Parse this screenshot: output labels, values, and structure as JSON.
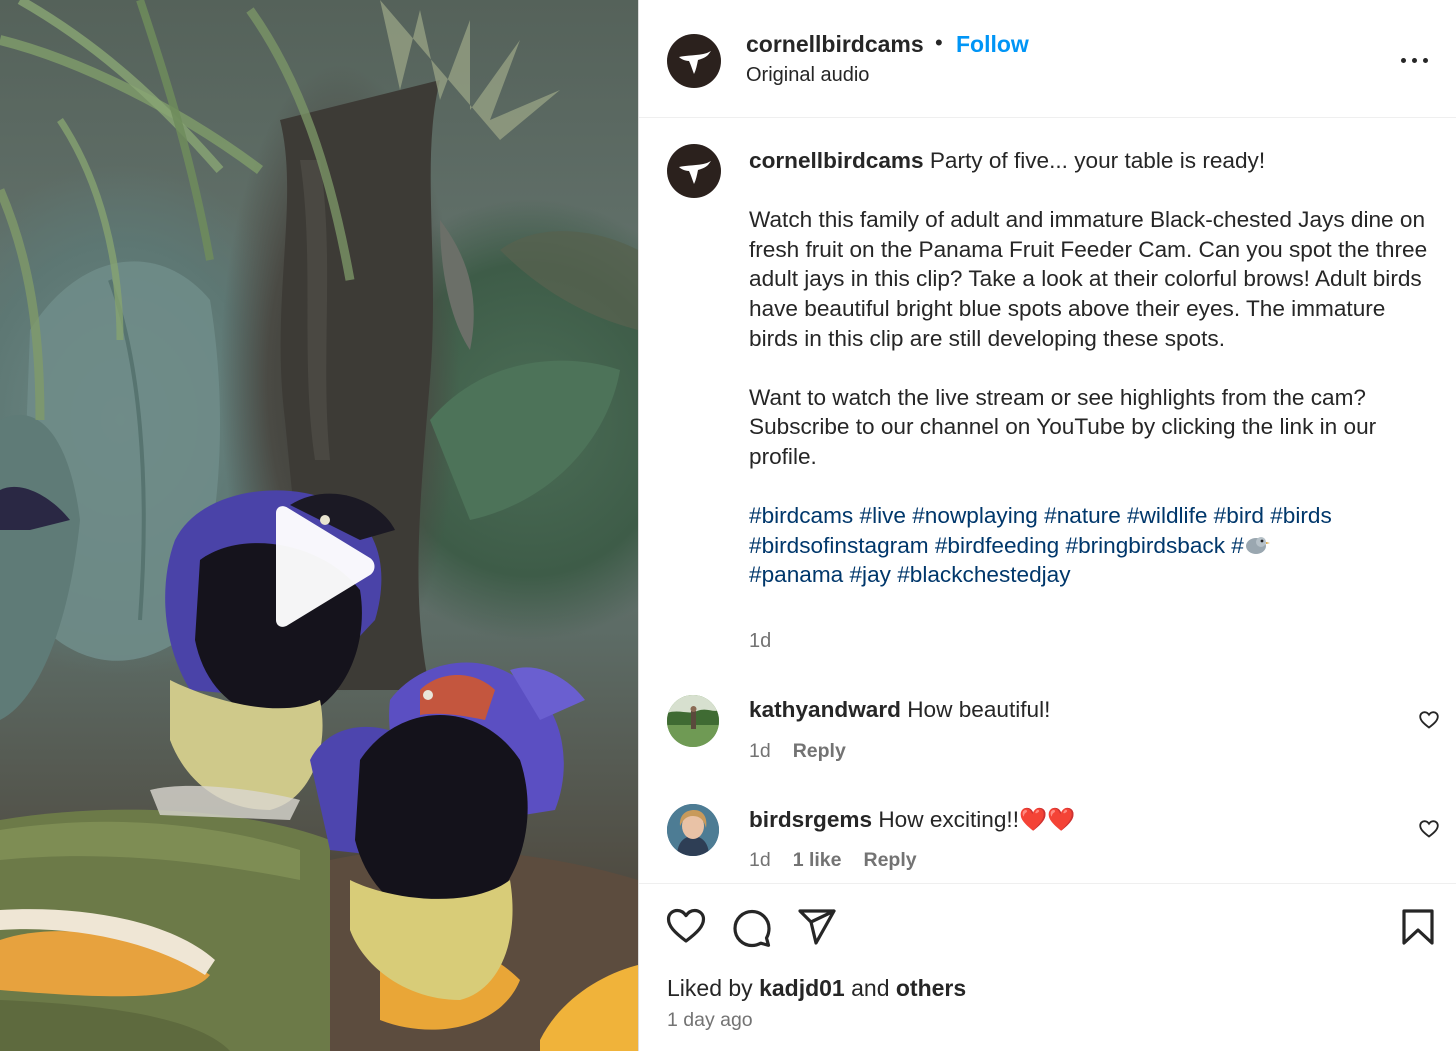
{
  "media": {
    "type": "video",
    "play_icon": "play-icon"
  },
  "post_header": {
    "username": "cornellbirdcams",
    "separator": "•",
    "follow_label": "Follow",
    "audio_label": "Original audio",
    "more_icon": "more-options-icon"
  },
  "caption": {
    "username": "cornellbirdcams",
    "lead": " Party of five... your table is ready!",
    "paragraph_1": "Watch this family of adult and immature Black-chested Jays dine on fresh fruit on the Panama Fruit Feeder Cam. Can you spot the three adult jays in this clip? Take a look at their colorful brows! Adult birds have beautiful bright blue spots above their eyes. The immature birds in this clip are still developing these spots.",
    "paragraph_2": "Want to watch the live stream or see highlights from the cam? Subscribe to our channel on YouTube by clicking the link in our profile.",
    "hashtags_line_1": "#birdcams #live #nowplaying #nature #wildlife #bird #birds",
    "hashtags_line_2": "#birdsofinstagram #birdfeeding #bringbirdsback #",
    "hashtags_line_3": "#panama #jay #blackchestedjay",
    "time": "1d"
  },
  "comments": [
    {
      "username": "kathyandward",
      "text": " How beautiful!",
      "time": "1d",
      "likes": "",
      "reply_label": "Reply"
    },
    {
      "username": "birdsrgems",
      "text": " How exciting!!",
      "emoji": "❤️❤️",
      "time": "1d",
      "likes": "1 like",
      "reply_label": "Reply"
    }
  ],
  "actions": {
    "icons": [
      "heart-icon",
      "comment-icon",
      "share-icon",
      "bookmark-icon"
    ]
  },
  "likes": {
    "prefix": "Liked by ",
    "user": "kadjd01",
    "middle": " and ",
    "others": "others"
  },
  "posted_ago": "1 day ago",
  "colors": {
    "link_blue": "#0095f6",
    "hashtag_blue": "#00376b",
    "secondary_text": "#737373",
    "avatar_bg": "#2b211d",
    "heart_red": "#e0241b"
  }
}
